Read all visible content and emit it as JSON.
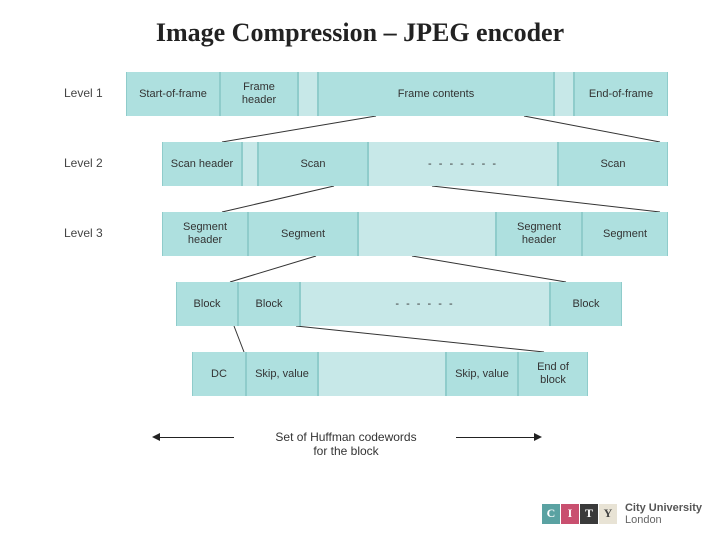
{
  "title": "Image Compression – JPEG encoder",
  "levels": {
    "l1": {
      "label": "Level 1",
      "cells": [
        "Start-of-frame",
        "Frame header",
        "Frame contents",
        "End-of-frame"
      ]
    },
    "l2": {
      "label": "Level 2",
      "cells": [
        "Scan header",
        "Scan",
        "- - - - - - -",
        "Scan"
      ]
    },
    "l3": {
      "label": "Level 3",
      "cells": [
        "Segment header",
        "Segment",
        "Segment header",
        "Segment"
      ]
    },
    "l4": {
      "cells": [
        "Block",
        "Block",
        "- - - - - -",
        "Block"
      ]
    },
    "l5": {
      "cells": [
        "DC",
        "Skip, value",
        "Skip, value",
        "End of block"
      ]
    }
  },
  "footer": "Set of Huffman codewords\nfor the block",
  "logo": {
    "tiles": [
      "C",
      "I",
      "T",
      "Y"
    ],
    "line1": "City University",
    "line2": "London"
  }
}
